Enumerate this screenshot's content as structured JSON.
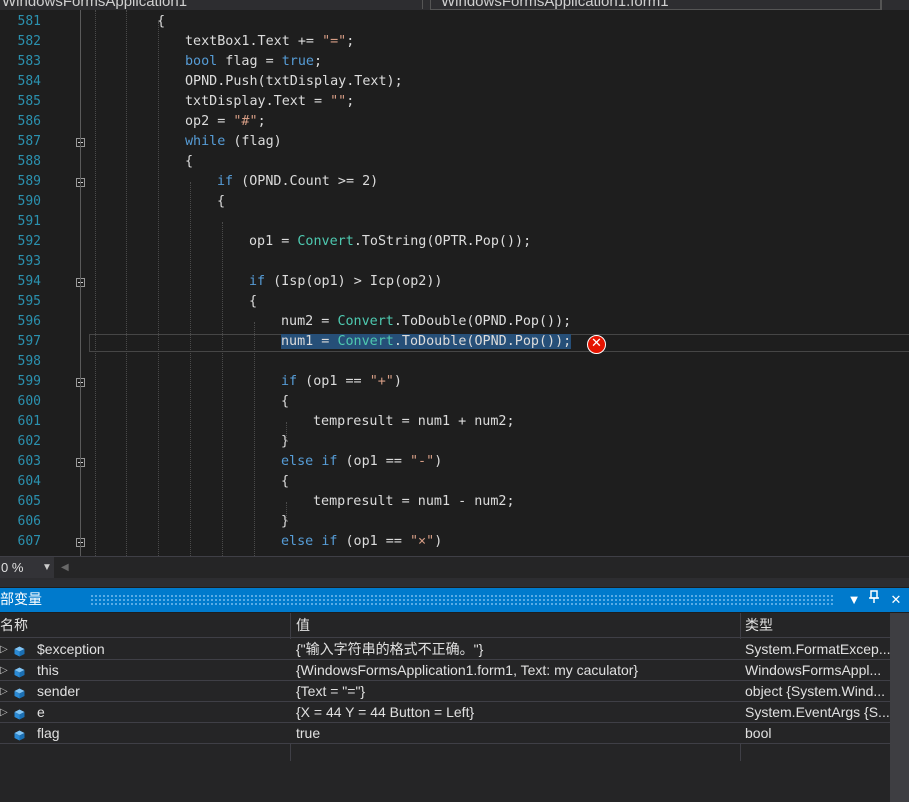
{
  "tabs": [
    {
      "label": "WindowsFormsApplication1"
    },
    {
      "label": "WindowsFormsApplication1.form1"
    }
  ],
  "editor": {
    "lines": [
      {
        "num": "581",
        "code": "{",
        "indent": 0
      },
      {
        "num": "582",
        "code": "textBox1.Text += \"=\";",
        "indent": 1
      },
      {
        "num": "583",
        "code": "bool flag = true;",
        "indent": 1
      },
      {
        "num": "584",
        "code": "OPND.Push(txtDisplay.Text);",
        "indent": 1
      },
      {
        "num": "585",
        "code": "txtDisplay.Text = \"\";",
        "indent": 1
      },
      {
        "num": "586",
        "code": "op2 = \"#\";",
        "indent": 1
      },
      {
        "num": "587",
        "code": "while (flag)",
        "indent": 1
      },
      {
        "num": "588",
        "code": "{",
        "indent": 1
      },
      {
        "num": "589",
        "code": "if (OPND.Count >= 2)",
        "indent": 2
      },
      {
        "num": "590",
        "code": "{",
        "indent": 2
      },
      {
        "num": "591",
        "code": "",
        "indent": 3
      },
      {
        "num": "592",
        "code": "op1 = Convert.ToString(OPTR.Pop());",
        "indent": 3
      },
      {
        "num": "593",
        "code": "",
        "indent": 3
      },
      {
        "num": "594",
        "code": "if (Isp(op1) > Icp(op2))",
        "indent": 3
      },
      {
        "num": "595",
        "code": "{",
        "indent": 3
      },
      {
        "num": "596",
        "code": "num2 = Convert.ToDouble(OPND.Pop());",
        "indent": 4
      },
      {
        "num": "597",
        "code": "num1 = Convert.ToDouble(OPND.Pop());",
        "indent": 4
      },
      {
        "num": "598",
        "code": "",
        "indent": 4
      },
      {
        "num": "599",
        "code": "if (op1 == \"+\")",
        "indent": 4
      },
      {
        "num": "600",
        "code": "{",
        "indent": 4
      },
      {
        "num": "601",
        "code": "tempresult = num1 + num2;",
        "indent": 5
      },
      {
        "num": "602",
        "code": "}",
        "indent": 4
      },
      {
        "num": "603",
        "code": "else if (op1 == \"-\")",
        "indent": 4
      },
      {
        "num": "604",
        "code": "{",
        "indent": 4
      },
      {
        "num": "605",
        "code": "tempresult = num1 - num2;",
        "indent": 5
      },
      {
        "num": "606",
        "code": "}",
        "indent": 4
      },
      {
        "num": "607",
        "code": "else if (op1 == \"×\")",
        "indent": 4
      }
    ],
    "selected_line": "597"
  },
  "zoom": {
    "value": "0 %"
  },
  "locals_panel": {
    "title": "部变量",
    "columns": {
      "name": "名称",
      "value": "值",
      "type": "类型"
    },
    "rows": [
      {
        "name": "$exception",
        "value": "{\"输入字符串的格式不正确。\"}",
        "type": "System.FormatExcep...",
        "expandable": true
      },
      {
        "name": "this",
        "value": "{WindowsFormsApplication1.form1, Text: my caculator}",
        "type": "WindowsFormsAppl...",
        "expandable": true
      },
      {
        "name": "sender",
        "value": "{Text = \"=\"}",
        "type": "object {System.Wind...",
        "expandable": true
      },
      {
        "name": "e",
        "value": "{X = 44 Y = 44 Button = Left}",
        "type": "System.EventArgs {S...",
        "expandable": true
      },
      {
        "name": "flag",
        "value": "true",
        "type": "bool",
        "expandable": false
      }
    ]
  },
  "colors": {
    "keyword": "#569cd6",
    "string": "#d69d85",
    "class": "#4ec9b0",
    "line_number": "#2b91af",
    "panel_header": "#007acc",
    "error": "#e51400"
  },
  "icons": {
    "dropdown": "chevron-down-icon",
    "pin": "pin-icon",
    "close": "close-icon",
    "error": "error-icon",
    "variable": "cube-icon",
    "expand": "expand-arrow-icon"
  }
}
